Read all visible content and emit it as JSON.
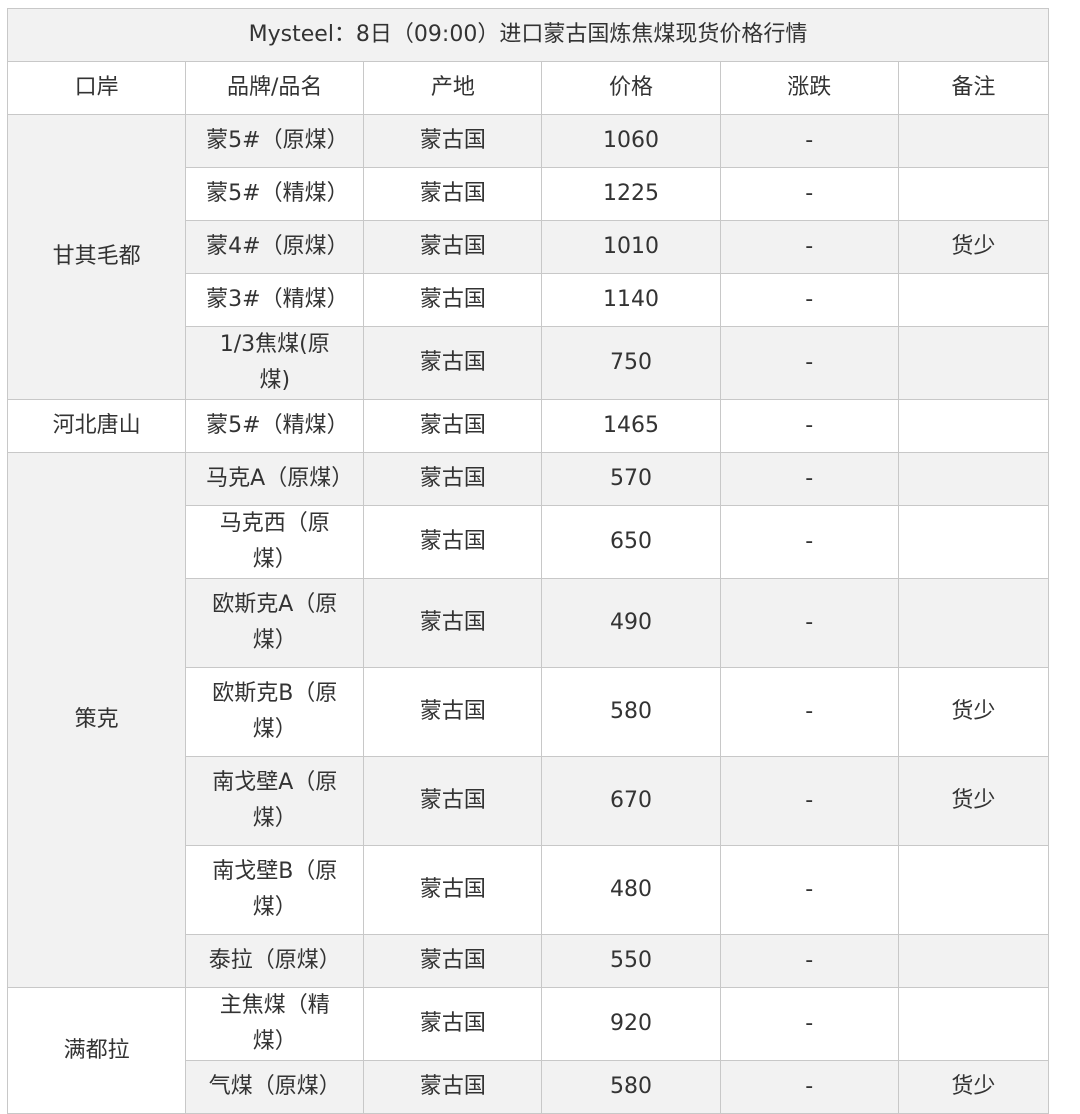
{
  "title": "Mysteel：8日（09:00）进口蒙古国炼焦煤现货价格行情",
  "headers": [
    "口岸",
    "品牌/品名",
    "产地",
    "价格",
    "涨跌",
    "备注"
  ],
  "rows": [
    {
      "port": "甘其毛都",
      "brand": "蒙5#（原煤）",
      "origin": "蒙古国",
      "price": "1060",
      "change": "-",
      "note": ""
    },
    {
      "brand": "蒙5#（精煤）",
      "origin": "蒙古国",
      "price": "1225",
      "change": "-",
      "note": ""
    },
    {
      "brand": "蒙4#（原煤）",
      "origin": "蒙古国",
      "price": "1010",
      "change": "-",
      "note": "货少"
    },
    {
      "brand": "蒙3#（精煤）",
      "origin": "蒙古国",
      "price": "1140",
      "change": "-",
      "note": ""
    },
    {
      "brand": "1/3焦煤(原煤)",
      "origin": "蒙古国",
      "price": "750",
      "change": "-",
      "note": ""
    },
    {
      "port": "河北唐山",
      "brand": "蒙5#（精煤）",
      "origin": "蒙古国",
      "price": "1465",
      "change": "-",
      "note": ""
    },
    {
      "port": "策克",
      "brand": "马克A（原煤）",
      "origin": "蒙古国",
      "price": "570",
      "change": "-",
      "note": ""
    },
    {
      "brand": "马克西（原煤）",
      "origin": "蒙古国",
      "price": "650",
      "change": "-",
      "note": ""
    },
    {
      "brand": "欧斯克A（原煤）",
      "origin": "蒙古国",
      "price": "490",
      "change": "-",
      "note": ""
    },
    {
      "brand": "欧斯克B（原煤）",
      "origin": "蒙古国",
      "price": "580",
      "change": "-",
      "note": "货少"
    },
    {
      "brand": "南戈壁A（原煤）",
      "origin": "蒙古国",
      "price": "670",
      "change": "-",
      "note": "货少"
    },
    {
      "brand": "南戈壁B（原煤）",
      "origin": "蒙古国",
      "price": "480",
      "change": "-",
      "note": ""
    },
    {
      "brand": "泰拉（原煤）",
      "origin": "蒙古国",
      "price": "550",
      "change": "-",
      "note": ""
    },
    {
      "port": "满都拉",
      "brand": "主焦煤（精煤）",
      "origin": "蒙古国",
      "price": "920",
      "change": "-",
      "note": ""
    },
    {
      "brand": "气煤（原煤）",
      "origin": "蒙古国",
      "price": "580",
      "change": "-",
      "note": "货少"
    }
  ]
}
